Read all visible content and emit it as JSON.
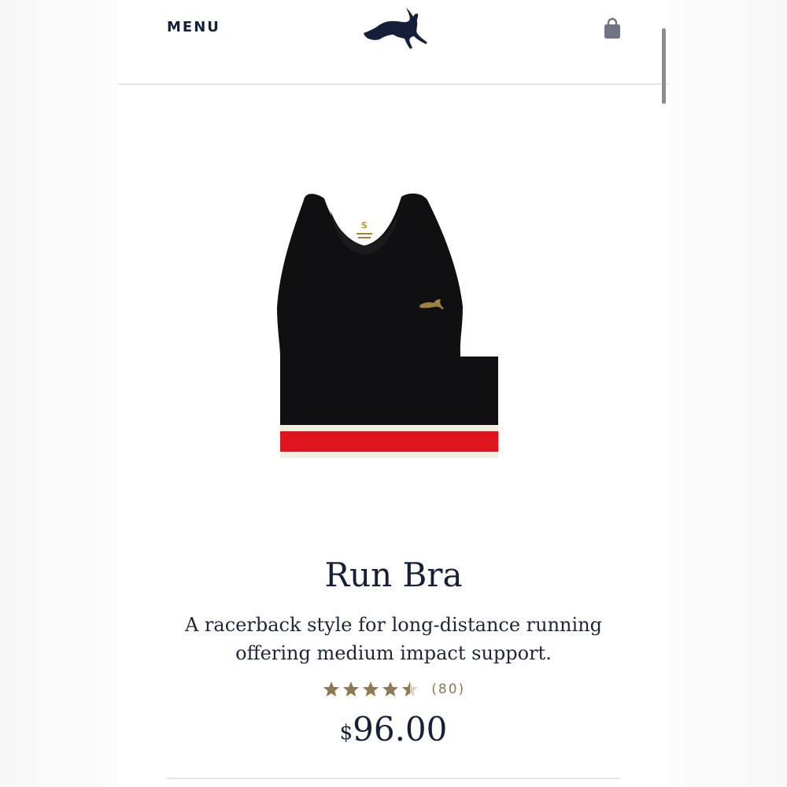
{
  "header": {
    "menu_label": "MENU",
    "logo_icon": "running-hare-logo",
    "bag_icon": "shopping-bag-icon"
  },
  "product": {
    "image_label": "S",
    "title": "Run Bra",
    "description": "A racerback style for long-distance running offering medium impact support.",
    "rating": 4.5,
    "rating_max": 5,
    "review_count": "(80)",
    "currency_symbol": "$",
    "price": "96.00"
  },
  "colors": {
    "navy": "#14203a",
    "gold": "#8e7a52",
    "star_empty": "#d9d4c6",
    "band_red": "#e0141f",
    "band_cream": "#f1ede1",
    "garment": "#101012"
  }
}
